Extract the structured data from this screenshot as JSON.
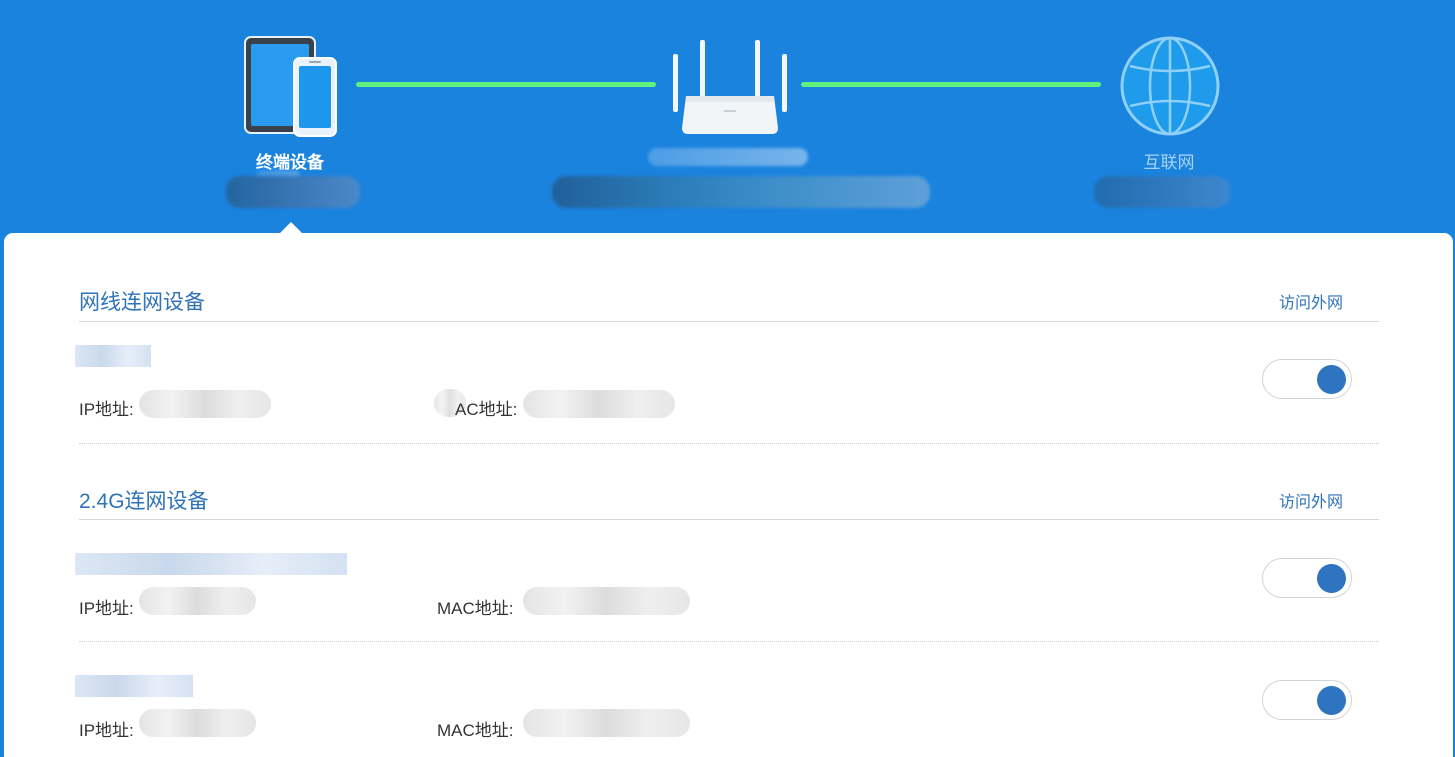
{
  "topology": {
    "terminal_label": "终端设备",
    "internet_label": "互联网"
  },
  "sections": [
    {
      "title": "网线连网设备",
      "action": "访问外网",
      "devices": [
        {
          "ip_label": "IP地址:",
          "mac_label": "AC地址:",
          "access_on": true
        }
      ]
    },
    {
      "title": "2.4G连网设备",
      "action": "访问外网",
      "devices": [
        {
          "ip_label": "IP地址:",
          "mac_label": "MAC地址:",
          "access_on": true
        },
        {
          "ip_label": "IP地址:",
          "mac_label": "MAC地址:",
          "access_on": true
        }
      ]
    }
  ],
  "colors": {
    "header_bg": "#1a83de",
    "link_line": "#5ff07e",
    "accent_text": "#2f73b8",
    "toggle_knob": "#2f74c0"
  },
  "icons": [
    "tablet-phone-icon",
    "router-icon",
    "globe-icon"
  ]
}
